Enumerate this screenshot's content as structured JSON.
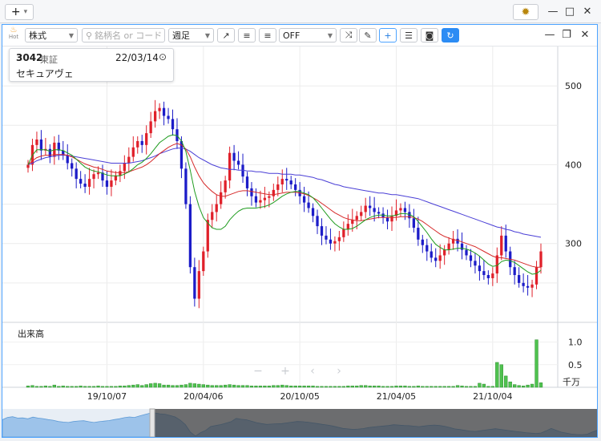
{
  "topbar": {
    "add_icon": "+",
    "gear_icon": "gear-icon",
    "minimize": "—",
    "maximize": "□",
    "close": "✕"
  },
  "toolbar": {
    "hot_label": "Hot",
    "market": "株式",
    "search_placeholder": "銘柄名 or コード",
    "period": "週足",
    "indicator": "OFF"
  },
  "panel_controls": {
    "minimize": "—",
    "restore": "❐",
    "close": "✕"
  },
  "info": {
    "code": "3042",
    "exchange": "東証",
    "date": "22/03/14",
    "name": "セキュアヴェ"
  },
  "volume_label": "出来高",
  "volume_unit": "千万",
  "colors": {
    "up": "#e0202a",
    "down": "#1c1cc8",
    "ma_short": "#1d9b1d",
    "ma_mid": "#d62a2a",
    "ma_long": "#4a3fd6",
    "accent": "#2c8cf4"
  },
  "chart_data": {
    "type": "candlestick",
    "price_axis_ticks": [
      "500",
      "400",
      "300"
    ],
    "price_ylim": [
      200,
      550
    ],
    "volume_axis_ticks": [
      "1.0",
      "0.5"
    ],
    "volume_ylim": [
      0,
      1.4
    ],
    "x_tick_labels": [
      "19/10/07",
      "20/04/06",
      "20/10/05",
      "21/04/05",
      "21/10/04"
    ],
    "series": [
      {
        "name": "close",
        "values": [
          400,
          425,
          432,
          418,
          420,
          410,
          428,
          418,
          412,
          402,
          395,
          382,
          376,
          372,
          382,
          388,
          390,
          380,
          372,
          380,
          386,
          392,
          402,
          410,
          422,
          430,
          425,
          440,
          455,
          468,
          472,
          462,
          458,
          445,
          430,
          395,
          350,
          270,
          230,
          265,
          290,
          330,
          340,
          350,
          365,
          380,
          415,
          405,
          400,
          385,
          370,
          360,
          352,
          355,
          358,
          360,
          368,
          375,
          382,
          380,
          375,
          368,
          360,
          352,
          345,
          335,
          322,
          310,
          305,
          300,
          303,
          308,
          318,
          325,
          330,
          335,
          340,
          348,
          345,
          340,
          338,
          333,
          328,
          335,
          342,
          345,
          340,
          332,
          320,
          305,
          298,
          290,
          282,
          278,
          285,
          292,
          300,
          306,
          300,
          292,
          285,
          278,
          272,
          265,
          260,
          256,
          262,
          285,
          310,
          290,
          270,
          260,
          250,
          246,
          244,
          248,
          270,
          290
        ]
      },
      {
        "name": "ma_short",
        "values": [
          400,
          412,
          419,
          419,
          419,
          417,
          419,
          419,
          418,
          415,
          412,
          407,
          402,
          397,
          394,
          392,
          391,
          389,
          387,
          386,
          386,
          386,
          388,
          391,
          395,
          400,
          403,
          408,
          414,
          421,
          428,
          432,
          436,
          438,
          437,
          430,
          417,
          393,
          366,
          347,
          333,
          326,
          320,
          318,
          318,
          322,
          330,
          336,
          341,
          344,
          345,
          345,
          345,
          346,
          347,
          349,
          352,
          356,
          360,
          363,
          365,
          366,
          366,
          364,
          362,
          358,
          352,
          345,
          338,
          331,
          325,
          321,
          318,
          318,
          319,
          322,
          326,
          330,
          333,
          335,
          336,
          336,
          335,
          335,
          336,
          338,
          338,
          337,
          334,
          328,
          321,
          314,
          306,
          299,
          295,
          292,
          292,
          293,
          294,
          294,
          293,
          291,
          288,
          284,
          279,
          274,
          271,
          272,
          277,
          279,
          278,
          276,
          272,
          268,
          264,
          261,
          262,
          266
        ]
      },
      {
        "name": "ma_mid",
        "values": [
          400,
          405,
          409,
          411,
          412,
          412,
          413,
          413,
          413,
          412,
          410,
          407,
          404,
          401,
          399,
          397,
          396,
          394,
          392,
          391,
          390,
          390,
          390,
          391,
          393,
          395,
          397,
          400,
          404,
          409,
          414,
          418,
          422,
          425,
          427,
          425,
          420,
          410,
          397,
          386,
          377,
          371,
          366,
          362,
          360,
          360,
          362,
          364,
          366,
          367,
          367,
          366,
          365,
          364,
          363,
          362,
          362,
          363,
          364,
          365,
          365,
          365,
          364,
          363,
          361,
          358,
          355,
          351,
          347,
          343,
          339,
          336,
          333,
          331,
          330,
          329,
          329,
          330,
          331,
          332,
          333,
          333,
          333,
          333,
          333,
          334,
          334,
          334,
          333,
          331,
          328,
          324,
          320,
          316,
          312,
          309,
          307,
          305,
          304,
          302,
          300,
          298,
          296,
          293,
          290,
          287,
          284,
          282,
          282,
          281,
          280,
          279,
          277,
          275,
          273,
          271,
          270,
          270
        ]
      },
      {
        "name": "ma_long",
        "values": [
          400,
          402,
          405,
          407,
          409,
          410,
          411,
          412,
          412,
          412,
          411,
          410,
          409,
          408,
          407,
          406,
          405,
          404,
          403,
          402,
          402,
          402,
          402,
          402,
          403,
          404,
          405,
          407,
          409,
          411,
          414,
          416,
          418,
          420,
          421,
          421,
          420,
          417,
          413,
          409,
          406,
          403,
          400,
          398,
          396,
          395,
          394,
          394,
          393,
          393,
          392,
          392,
          391,
          391,
          390,
          389,
          389,
          389,
          388,
          388,
          388,
          387,
          387,
          386,
          385,
          384,
          382,
          381,
          379,
          377,
          375,
          374,
          372,
          371,
          370,
          369,
          368,
          367,
          366,
          365,
          364,
          364,
          363,
          362,
          362,
          361,
          360,
          359,
          358,
          357,
          355,
          353,
          351,
          349,
          347,
          345,
          343,
          341,
          339,
          337,
          335,
          333,
          331,
          329,
          327,
          325,
          323,
          321,
          320,
          318,
          317,
          315,
          314,
          312,
          311,
          310,
          309,
          308
        ]
      },
      {
        "name": "volume",
        "values": [
          0.03,
          0.04,
          0.02,
          0.02,
          0.03,
          0.02,
          0.05,
          0.02,
          0.03,
          0.02,
          0.02,
          0.02,
          0.03,
          0.02,
          0.02,
          0.02,
          0.03,
          0.02,
          0.02,
          0.02,
          0.02,
          0.03,
          0.03,
          0.04,
          0.05,
          0.06,
          0.04,
          0.06,
          0.08,
          0.09,
          0.08,
          0.05,
          0.05,
          0.04,
          0.04,
          0.05,
          0.06,
          0.09,
          0.08,
          0.07,
          0.06,
          0.05,
          0.04,
          0.04,
          0.04,
          0.05,
          0.06,
          0.05,
          0.04,
          0.04,
          0.04,
          0.03,
          0.03,
          0.03,
          0.03,
          0.03,
          0.04,
          0.04,
          0.05,
          0.04,
          0.03,
          0.03,
          0.03,
          0.03,
          0.03,
          0.03,
          0.02,
          0.02,
          0.02,
          0.02,
          0.02,
          0.02,
          0.02,
          0.03,
          0.03,
          0.03,
          0.04,
          0.04,
          0.03,
          0.03,
          0.03,
          0.02,
          0.02,
          0.02,
          0.03,
          0.03,
          0.03,
          0.02,
          0.02,
          0.03,
          0.02,
          0.02,
          0.02,
          0.02,
          0.02,
          0.02,
          0.02,
          0.02,
          0.04,
          0.03,
          0.02,
          0.02,
          0.02,
          0.09,
          0.07,
          0.02,
          0.02,
          0.55,
          0.5,
          0.25,
          0.12,
          0.06,
          0.04,
          0.03,
          0.05,
          0.07,
          1.05,
          0.1
        ]
      }
    ]
  }
}
